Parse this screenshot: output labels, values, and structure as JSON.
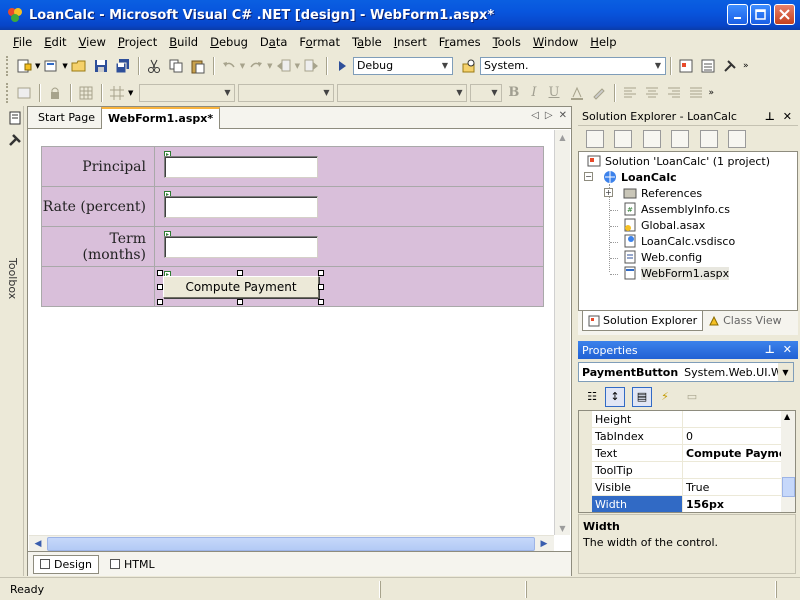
{
  "window": {
    "title": "LoanCalc - Microsoft Visual C# .NET [design] - WebForm1.aspx*"
  },
  "menu": {
    "items": [
      {
        "pre": "",
        "key": "F",
        "post": "ile"
      },
      {
        "pre": "",
        "key": "E",
        "post": "dit"
      },
      {
        "pre": "",
        "key": "V",
        "post": "iew"
      },
      {
        "pre": "",
        "key": "P",
        "post": "roject"
      },
      {
        "pre": "",
        "key": "B",
        "post": "uild"
      },
      {
        "pre": "",
        "key": "D",
        "post": "ebug"
      },
      {
        "pre": "D",
        "key": "a",
        "post": "ta"
      },
      {
        "pre": "F",
        "key": "o",
        "post": "rmat"
      },
      {
        "pre": "T",
        "key": "a",
        "post": "ble"
      },
      {
        "pre": "",
        "key": "I",
        "post": "nsert"
      },
      {
        "pre": "F",
        "key": "r",
        "post": "ames"
      },
      {
        "pre": "",
        "key": "T",
        "post": "ools"
      },
      {
        "pre": "",
        "key": "W",
        "post": "indow"
      },
      {
        "pre": "",
        "key": "H",
        "post": "elp"
      }
    ]
  },
  "toolbar": {
    "config_value": "Debug",
    "search_value": "System.",
    "format_letters": [
      "B",
      "I",
      "U"
    ]
  },
  "toolbox": {
    "label": "Toolbox"
  },
  "document": {
    "tabs": [
      "Start Page",
      "WebForm1.aspx*"
    ],
    "form": {
      "rows": [
        {
          "label": "Principal"
        },
        {
          "label": "Rate (percent)"
        },
        {
          "label": "Term (months)"
        }
      ],
      "button_label": "Compute Payment"
    },
    "view_tabs": [
      "Design",
      "HTML"
    ]
  },
  "solution_explorer": {
    "title": "Solution Explorer - LoanCalc",
    "tree": {
      "solution": "Solution 'LoanCalc' (1 project)",
      "project": "LoanCalc",
      "items": [
        "References",
        "AssemblyInfo.cs",
        "Global.asax",
        "LoanCalc.vsdisco",
        "Web.config",
        "WebForm1.aspx"
      ]
    },
    "tabs": [
      "Solution Explorer",
      "Class View"
    ]
  },
  "properties": {
    "title": "Properties",
    "object_name": "PaymentButton",
    "object_type": "System.Web.UI.WebControls.Button",
    "rows": [
      {
        "name": "Height",
        "value": ""
      },
      {
        "name": "TabIndex",
        "value": "0"
      },
      {
        "name": "Text",
        "value": "Compute Payment"
      },
      {
        "name": "ToolTip",
        "value": ""
      },
      {
        "name": "Visible",
        "value": "True"
      },
      {
        "name": "Width",
        "value": "156px"
      }
    ],
    "desc_title": "Width",
    "desc_text": "The width of the control."
  },
  "status": {
    "text": "Ready"
  },
  "colors": {
    "titlebar": "#0A5FE1",
    "form_background": "#D9BFDA",
    "selection": "#316AC5"
  }
}
